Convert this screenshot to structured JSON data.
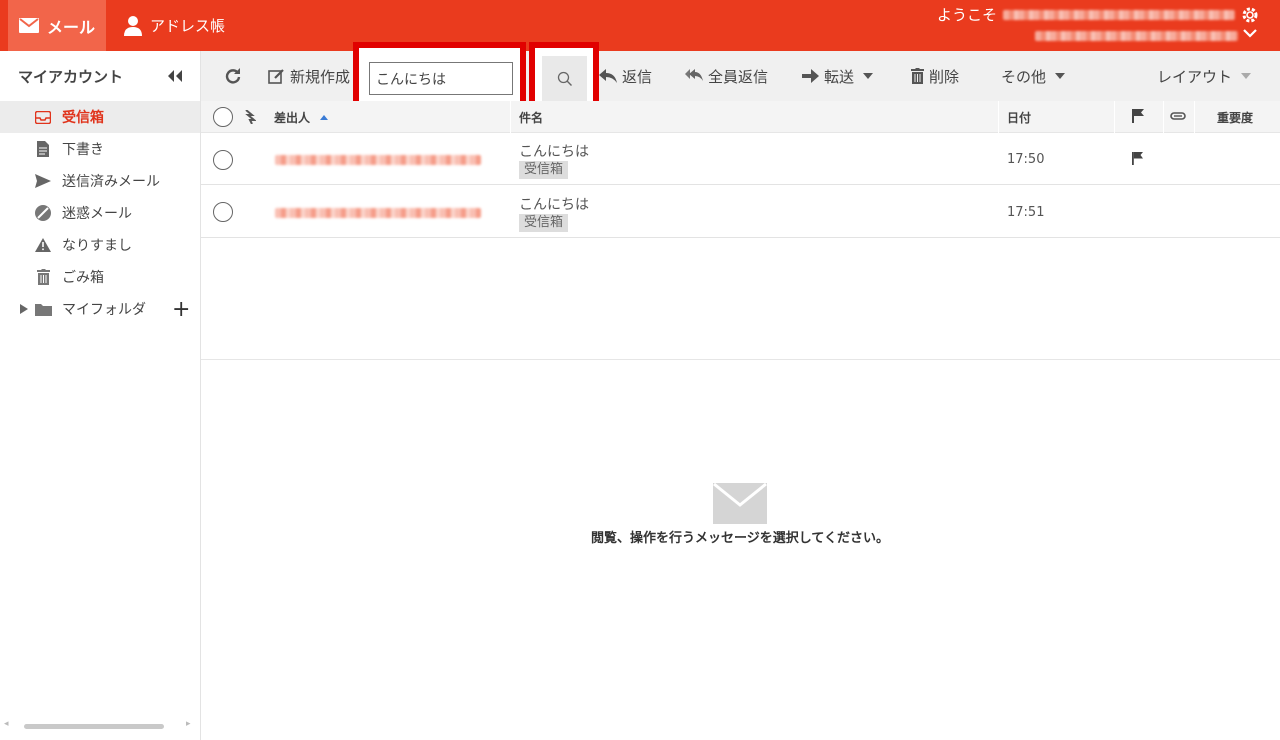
{
  "header": {
    "mail_tab": "メール",
    "address_tab": "アドレス帳",
    "welcome": "ようこそ"
  },
  "sidebar": {
    "title": "マイアカウント",
    "folders": [
      {
        "label": "受信箱",
        "icon": "inbox-icon"
      },
      {
        "label": "下書き",
        "icon": "draft-icon"
      },
      {
        "label": "送信済みメール",
        "icon": "send-icon"
      },
      {
        "label": "迷惑メール",
        "icon": "spam-icon"
      },
      {
        "label": "なりすまし",
        "icon": "warning-icon"
      },
      {
        "label": "ごみ箱",
        "icon": "trash-icon"
      },
      {
        "label": "マイフォルダ",
        "icon": "folder-icon"
      }
    ]
  },
  "toolbar": {
    "compose": "新規作成",
    "search_value": "こんにちは",
    "reply": "返信",
    "reply_all": "全員返信",
    "forward": "転送",
    "delete": "削除",
    "other": "その他",
    "layout": "レイアウト"
  },
  "list": {
    "columns": {
      "sender": "差出人",
      "subject": "件名",
      "date": "日付",
      "priority": "重要度"
    },
    "rows": [
      {
        "subject": "こんにちは",
        "folder": "受信箱",
        "date": "17:50",
        "flagged": true
      },
      {
        "subject": "こんにちは",
        "folder": "受信箱",
        "date": "17:51",
        "flagged": false
      }
    ]
  },
  "preview": {
    "message": "閲覧、操作を行うメッセージを選択してください。"
  },
  "colors": {
    "brand": "#ea3b1e",
    "highlight": "#e10000"
  }
}
